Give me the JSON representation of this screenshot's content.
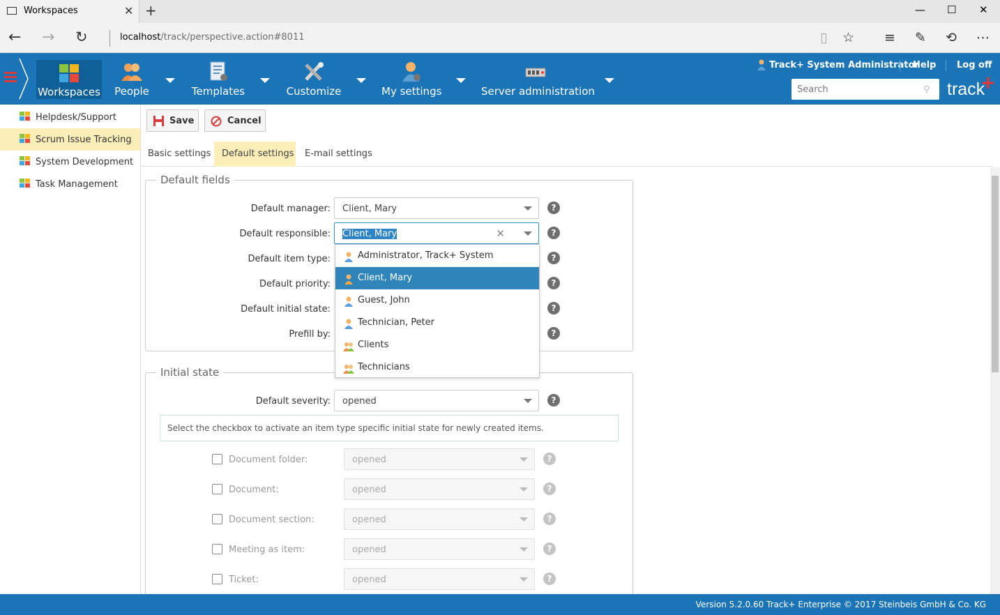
{
  "browser": {
    "tab_title": "Workspaces",
    "url_host": "localhost",
    "url_path": "/track/perspective.action#8011"
  },
  "app": {
    "nav": [
      {
        "label": "Workspaces",
        "icon": "puzzle-icon",
        "active": true
      },
      {
        "label": "People",
        "icon": "people-icon"
      },
      {
        "label": "Templates",
        "icon": "document-gear-icon"
      },
      {
        "label": "Customize",
        "icon": "tools-icon"
      },
      {
        "label": "My settings",
        "icon": "user-gear-icon"
      },
      {
        "label": "Server administration",
        "icon": "server-icon"
      }
    ],
    "user_name": "Track+ System Administrator",
    "help_label": "Help",
    "logout_label": "Log off",
    "search_placeholder": "Search",
    "brand": "track"
  },
  "sidebar": {
    "items": [
      {
        "label": "Helpdesk/Support"
      },
      {
        "label": "Scrum Issue Tracking",
        "selected": true
      },
      {
        "label": "System Development"
      },
      {
        "label": "Task Management"
      }
    ]
  },
  "toolbar": {
    "save_label": "Save",
    "cancel_label": "Cancel"
  },
  "tabs": [
    {
      "label": "Basic settings"
    },
    {
      "label": "Default settings",
      "active": true
    },
    {
      "label": "E-mail settings"
    }
  ],
  "default_fields": {
    "legend": "Default fields",
    "rows": [
      {
        "label": "Default manager:",
        "value": "Client, Mary"
      },
      {
        "label": "Default responsible:",
        "value": "Client, Mary"
      },
      {
        "label": "Default item type:"
      },
      {
        "label": "Default priority:"
      },
      {
        "label": "Default initial state:"
      },
      {
        "label": "Prefill by:"
      }
    ]
  },
  "dropdown": {
    "options": [
      {
        "label": "Administrator, Track+ System",
        "type": "user"
      },
      {
        "label": "Client, Mary",
        "type": "user",
        "highlighted": true
      },
      {
        "label": "Guest, John",
        "type": "user"
      },
      {
        "label": "Technician, Peter",
        "type": "user"
      },
      {
        "label": "Clients",
        "type": "group"
      },
      {
        "label": "Technicians",
        "type": "group"
      }
    ]
  },
  "initial_state": {
    "legend": "Initial state",
    "severity_label": "Default severity:",
    "severity_value": "opened",
    "info": "Select the checkbox to activate an item type specific initial state for newly created items.",
    "rows": [
      {
        "label": "Document folder:",
        "value": "opened"
      },
      {
        "label": "Document:",
        "value": "opened"
      },
      {
        "label": "Document section:",
        "value": "opened"
      },
      {
        "label": "Meeting as item:",
        "value": "opened"
      },
      {
        "label": "Ticket:",
        "value": "opened"
      }
    ]
  },
  "footer": {
    "text": "Version 5.2.0.60 Track+ Enterprise   © 2017 Steinbeis GmbH & Co. KG"
  },
  "colors": {
    "header_blue": "#1a74b6",
    "selected_yellow": "#fbeeb8",
    "highlight_blue": "#2f84b9"
  }
}
